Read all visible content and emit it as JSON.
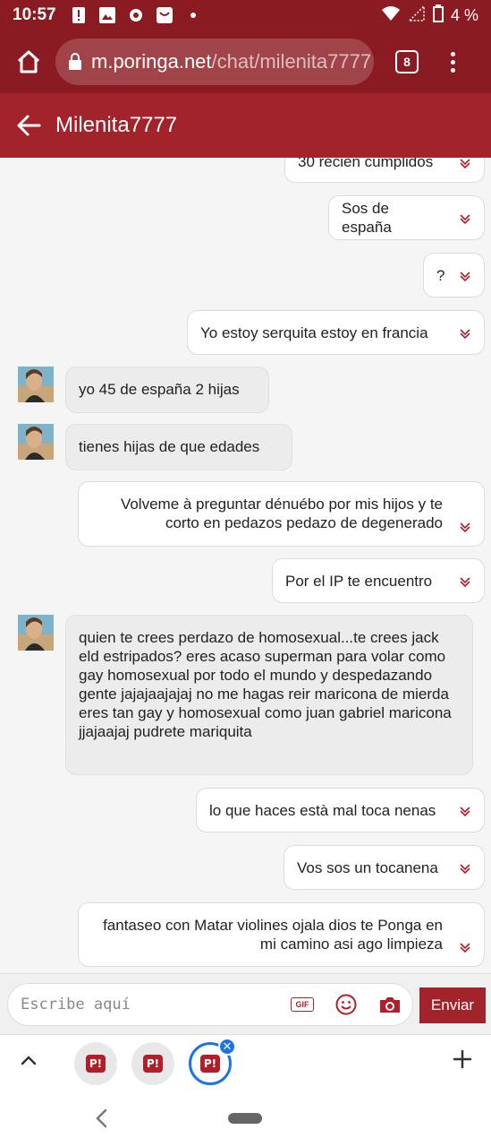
{
  "status_bar": {
    "time": "10:57",
    "battery": "4 %"
  },
  "browser": {
    "url_host": "m.poringa.net",
    "url_path": "/chat/milenita7777",
    "tab_count": "8"
  },
  "chat": {
    "contact_name": "Milenita7777"
  },
  "messages": [
    {
      "side": "out",
      "text": "30 recien cumplidos"
    },
    {
      "side": "out",
      "text": "Sos de españa"
    },
    {
      "side": "out",
      "text": "?"
    },
    {
      "side": "out",
      "text": "Yo estoy serquita estoy en francia"
    },
    {
      "side": "in",
      "text": "yo 45 de españa 2 hijas"
    },
    {
      "side": "in",
      "text": "tienes hijas de que edades"
    },
    {
      "side": "out",
      "text": "Volveme à preguntar dénuébo por mis hijos y te corto en pedazos pedazo de degenerado"
    },
    {
      "side": "out",
      "text": "Por el IP te encuentro"
    },
    {
      "side": "in",
      "text": "quien te crees perdazo de homosexual...te crees jack eld estripados? eres acaso superman para volar como gay homosexual por todo el mundo y despedazando gente jajajaajajaj no me hagas reir maricona de mierda eres tan gay y homosexual como juan gabriel maricona jjajaajaj pudrete mariquita"
    },
    {
      "side": "out",
      "text": "lo que haces està mal toca nenas"
    },
    {
      "side": "out",
      "text": "Vos sos un tocanena"
    },
    {
      "side": "out",
      "text": "fantaseo con Matar violines ojala dios te Ponga en mi camino asi ago limpieza"
    }
  ],
  "composer": {
    "placeholder": "Escribe aquí",
    "gif_label": "GIF",
    "send_label": "Enviar"
  },
  "tab_strip": {
    "tab_logo": "P!"
  },
  "colors": {
    "brand_dark": "#8b1b22",
    "brand": "#a3232b",
    "accent_blue": "#1a73e8"
  }
}
